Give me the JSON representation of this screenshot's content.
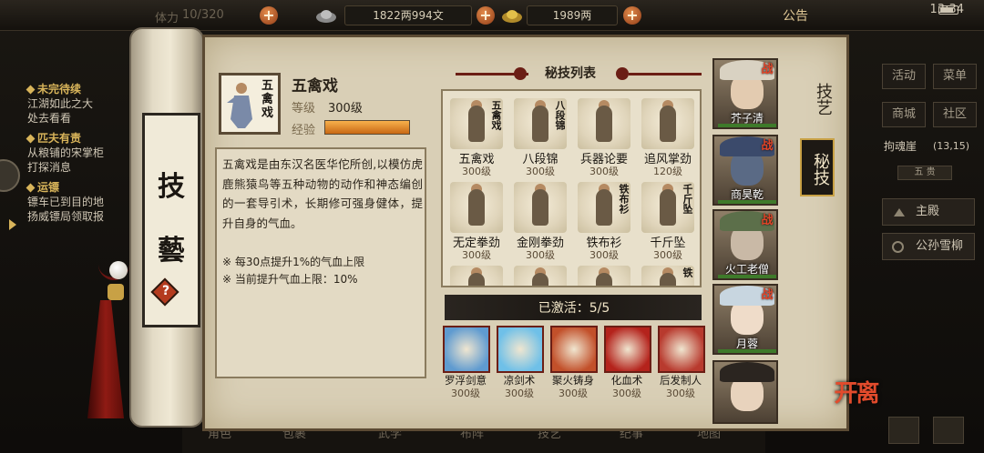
{
  "top_bar": {
    "capacity_label": "体力",
    "capacity_value": "10/320",
    "money": "1822两994文",
    "gold": "1989两",
    "announcement": "公告",
    "clock": "13:34"
  },
  "quest_log": {
    "items": [
      {
        "title": "未完待续",
        "lines": [
          "江湖如此之大",
          "处去看看"
        ]
      },
      {
        "title": "匹夫有责",
        "lines": [
          "从粮铺的宋掌柜",
          "打探消息"
        ]
      },
      {
        "title": "运镖",
        "lines": [
          "镖车已到目的地",
          "扬威镖局领取报"
        ]
      }
    ]
  },
  "right_menu": {
    "row1": [
      "活动",
      "菜单"
    ],
    "row2": [
      "商城",
      "社区"
    ],
    "location": "拘魂崖",
    "location_coord": "(13,15)",
    "squad_tab": "五 贵",
    "squad": [
      {
        "icon": "triangle-icon",
        "name": "主殿"
      },
      {
        "icon": "circle-icon",
        "name": "公孙雪柳"
      }
    ]
  },
  "scroll": {
    "title_char1": "技",
    "title_char2": "藝",
    "help": "?"
  },
  "selected_skill": {
    "name": "五禽戏",
    "level_label": "等级",
    "level_value": "300级",
    "exp_label": "经验",
    "exp_fraction": 1.0,
    "icon_glyph": "五禽戏",
    "description": "五禽戏是由东汉名医华佗所创,以模仿虎鹿熊猿鸟等五种动物的动作和神态编创的一套导引术，长期修可强身健体，提升自身的气血。",
    "note1": "※ 每30点提升1%的气血上限",
    "note2": "※ 当前提升气血上限：10%"
  },
  "skill_list": {
    "title": "秘技列表",
    "skills": [
      {
        "name": "五禽戏",
        "level": "300级",
        "glyph": "五禽戏"
      },
      {
        "name": "八段锦",
        "level": "300级",
        "glyph": "八段锦"
      },
      {
        "name": "兵器论要",
        "level": "300级",
        "glyph": ""
      },
      {
        "name": "追风掌劲",
        "level": "120级",
        "glyph": ""
      },
      {
        "name": "无定拳劲",
        "level": "300级",
        "glyph": ""
      },
      {
        "name": "金刚拳劲",
        "level": "300级",
        "glyph": ""
      },
      {
        "name": "铁布衫",
        "level": "300级",
        "glyph": "铁布衫"
      },
      {
        "name": "千斤坠",
        "level": "300级",
        "glyph": "千斤坠"
      },
      {
        "name": "",
        "level": "",
        "glyph": ""
      },
      {
        "name": "",
        "level": "",
        "glyph": ""
      },
      {
        "name": "",
        "level": "",
        "glyph": ""
      },
      {
        "name": "",
        "level": "",
        "glyph": "铁"
      }
    ]
  },
  "activated": {
    "label": "已激活：5/5",
    "skills": [
      {
        "name": "罗浮剑意",
        "level": "300级",
        "color": "#5f9bd0"
      },
      {
        "name": "凉剑术",
        "level": "300级",
        "color": "#6fc0e8"
      },
      {
        "name": "聚火铸身",
        "level": "300级",
        "color": "#c2502a"
      },
      {
        "name": "化血术",
        "level": "300级",
        "color": "#b4231c"
      },
      {
        "name": "后发制人",
        "level": "300级",
        "color": "#b83a2e"
      }
    ]
  },
  "characters": [
    {
      "name": "芥子清",
      "battle": "战",
      "hat": "#d9d2c2",
      "face": "#e3cbb0"
    },
    {
      "name": "商昊乾",
      "battle": "战",
      "hat": "#3b4a6b",
      "face": "#5a6a85"
    },
    {
      "name": "火工老僧",
      "battle": "战",
      "hat": "#5c6f4a",
      "face": "#c9b9a6"
    },
    {
      "name": "月蓉",
      "battle": "战",
      "hat": "#c8d6e0",
      "face": "#efdcc9"
    },
    {
      "name": "",
      "battle": "",
      "hat": "#2b2520",
      "face": "#e8d3bd"
    }
  ],
  "tabs": {
    "jiyi": "技艺",
    "miji": "秘技"
  },
  "leave_button": "离开",
  "bottom_nav": [
    "角色",
    "包裹",
    "武学",
    "布阵",
    "技艺",
    "纪事",
    "地图"
  ],
  "colors": {
    "parchment": "#d9cfb6",
    "accent_red": "#6b1e15",
    "exp_orange": "#f7b14c"
  }
}
